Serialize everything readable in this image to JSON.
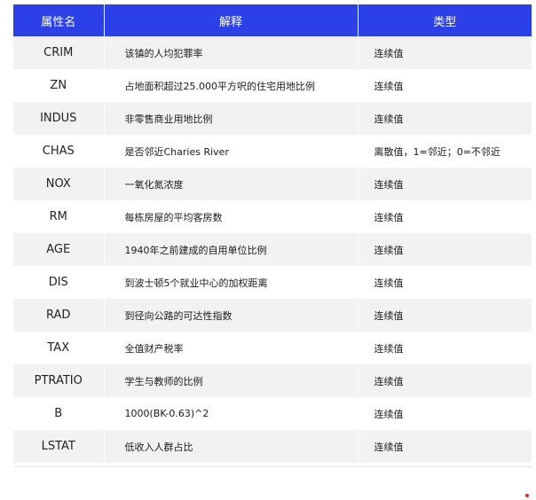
{
  "table": {
    "headers": [
      "属性名",
      "解释",
      "类型"
    ],
    "rows": [
      {
        "name": "CRIM",
        "desc": "该镇的人均犯罪率",
        "type": "连续值"
      },
      {
        "name": "ZN",
        "desc": "占地面积超过25.000平方呎的住宅用地比例",
        "type": "连续值"
      },
      {
        "name": "INDUS",
        "desc": "非零售商业用地比例",
        "type": "连续值"
      },
      {
        "name": "CHAS",
        "desc": "是否邻近Charies River",
        "type": "离散值，1=邻近；0=不邻近"
      },
      {
        "name": "NOX",
        "desc": "一氧化氮浓度",
        "type": "连续值"
      },
      {
        "name": "RM",
        "desc": "每栋房屋的平均客房数",
        "type": "连续值"
      },
      {
        "name": "AGE",
        "desc": "1940年之前建成的自用单位比例",
        "type": "连续值"
      },
      {
        "name": "DIS",
        "desc": "到波士顿5个就业中心的加权距离",
        "type": "连续值"
      },
      {
        "name": "RAD",
        "desc": "到径向公路的可达性指数",
        "type": "连续值"
      },
      {
        "name": "TAX",
        "desc": "全值财产税率",
        "type": "连续值"
      },
      {
        "name": "PTRATIO",
        "desc": "学生与教师的比例",
        "type": "连续值"
      },
      {
        "name": "B",
        "desc": "1000(BK-0.63)^2",
        "type": "连续值"
      },
      {
        "name": "LSTAT",
        "desc": "低收入人群占比",
        "type": "连续值"
      }
    ]
  },
  "colors": {
    "header_bg": "#2b40e6",
    "stripe_bg": "#f2f2f2",
    "dot": "#e0211b"
  }
}
